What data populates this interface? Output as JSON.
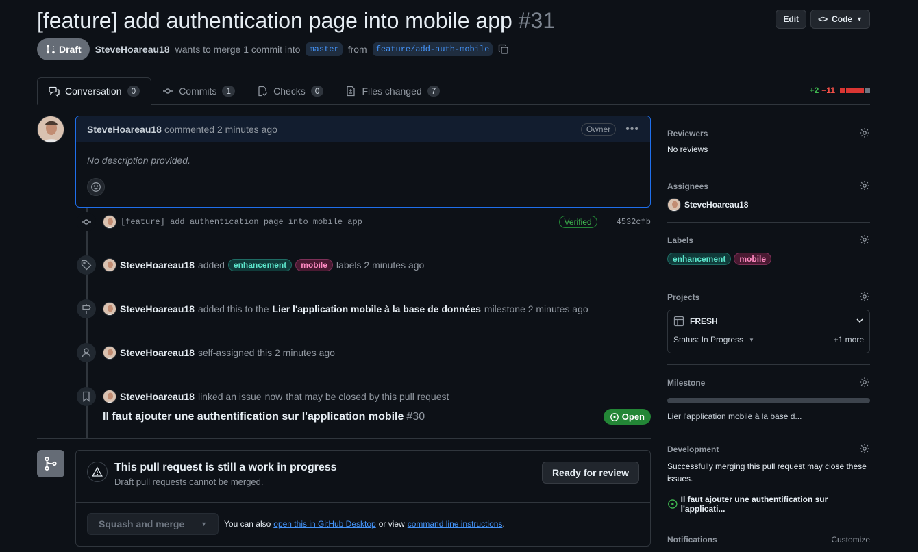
{
  "header": {
    "title": "[feature] add authentication page into mobile app",
    "number": "#31",
    "edit_label": "Edit",
    "code_label": "Code",
    "draft_label": "Draft",
    "author": "SteveHoareau18",
    "merge_text": "wants to merge 1 commit into",
    "base_branch": "master",
    "from_text": "from",
    "head_branch": "feature/add-auth-mobile"
  },
  "tabs": [
    {
      "label": "Conversation",
      "count": "0"
    },
    {
      "label": "Commits",
      "count": "1"
    },
    {
      "label": "Checks",
      "count": "0"
    },
    {
      "label": "Files changed",
      "count": "7"
    }
  ],
  "diffstat": {
    "additions": "+2",
    "deletions": "−11"
  },
  "comment": {
    "author": "SteveHoareau18",
    "action": "commented 2 minutes ago",
    "badge": "Owner",
    "body": "No description provided."
  },
  "commit": {
    "message": "[feature] add authentication page into mobile app",
    "verified": "Verified",
    "sha": "4532cfb"
  },
  "events": {
    "labels": {
      "actor": "SteveHoareau18",
      "pre": "added",
      "label1": "enhancement",
      "label2": "mobile",
      "post": "labels 2 minutes ago"
    },
    "milestone": {
      "actor": "SteveHoareau18",
      "pre": "added this to the",
      "milestone": "Lier l'application mobile à la base de données",
      "post": "milestone 2 minutes ago"
    },
    "assign": {
      "actor": "SteveHoareau18",
      "text": "self-assigned this 2 minutes ago"
    },
    "link": {
      "actor": "SteveHoareau18",
      "pre": "linked an issue",
      "when": "now",
      "post": "that may be closed by this pull request"
    }
  },
  "linked_issue": {
    "title": "Il faut ajouter une authentification sur l'application mobile",
    "number": "#30",
    "state": "Open"
  },
  "merge": {
    "title": "This pull request is still a work in progress",
    "subtitle": "Draft pull requests cannot be merged.",
    "ready_label": "Ready for review",
    "squash_label": "Squash and merge",
    "also_text": "You can also",
    "desktop_link": "open this in GitHub Desktop",
    "or_view": "or view",
    "cli_link": "command line instructions",
    "period": "."
  },
  "sidebar": {
    "reviewers": {
      "label": "Reviewers",
      "value": "No reviews"
    },
    "assignees": {
      "label": "Assignees",
      "value": "SteveHoareau18"
    },
    "labels": {
      "label": "Labels",
      "items": [
        "enhancement",
        "mobile"
      ]
    },
    "projects": {
      "label": "Projects",
      "name": "FRESH",
      "status": "Status: In Progress",
      "more": "+1 more"
    },
    "milestone": {
      "label": "Milestone",
      "value": "Lier l'application mobile à la base d...",
      "progress": 0
    },
    "development": {
      "label": "Development",
      "text": "Successfully merging this pull request may close these issues.",
      "issue": "Il faut ajouter une authentification sur l'applicati..."
    },
    "notifications": {
      "label": "Notifications",
      "customize": "Customize"
    }
  },
  "colors": {
    "accent": "#1f6feb",
    "success": "#238636",
    "danger": "#f85149",
    "draft": "#656c76"
  }
}
